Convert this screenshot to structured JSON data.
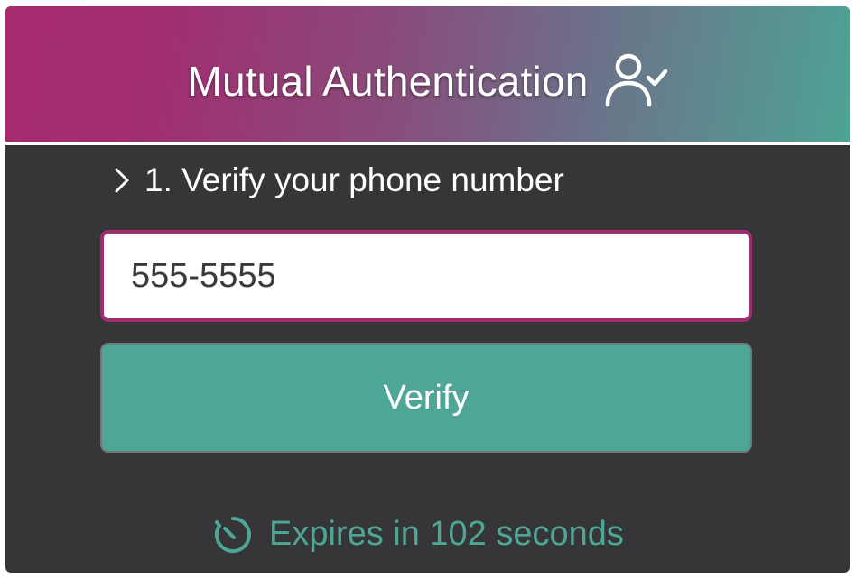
{
  "header": {
    "title": "Mutual Authentication",
    "icon": "user-check-icon"
  },
  "step": {
    "label": "1. Verify your phone number",
    "icon": "chevron-right-icon"
  },
  "phone_field": {
    "value": "555-5555",
    "placeholder": ""
  },
  "verify_button": {
    "label": "Verify"
  },
  "timer": {
    "text": "Expires in 102 seconds",
    "icon": "timer-icon"
  },
  "colors": {
    "accent_magenta": "#a12d71",
    "accent_teal": "#4ea697",
    "panel_bg": "#363638"
  }
}
